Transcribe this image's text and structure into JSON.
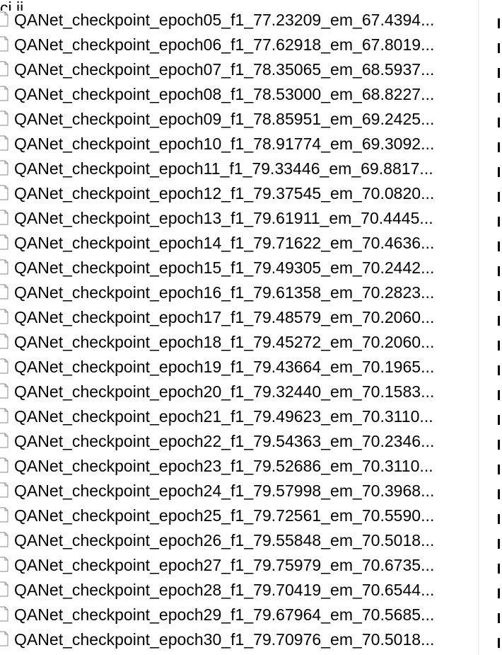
{
  "top_clipped_text": "ci ij",
  "files": [
    {
      "name": "QANet_checkpoint_epoch05_f1_77.23209_em_67.4394..."
    },
    {
      "name": "QANet_checkpoint_epoch06_f1_77.62918_em_67.8019..."
    },
    {
      "name": "QANet_checkpoint_epoch07_f1_78.35065_em_68.5937..."
    },
    {
      "name": "QANet_checkpoint_epoch08_f1_78.53000_em_68.8227..."
    },
    {
      "name": "QANet_checkpoint_epoch09_f1_78.85951_em_69.2425..."
    },
    {
      "name": "QANet_checkpoint_epoch10_f1_78.91774_em_69.3092..."
    },
    {
      "name": "QANet_checkpoint_epoch11_f1_79.33446_em_69.8817..."
    },
    {
      "name": "QANet_checkpoint_epoch12_f1_79.37545_em_70.0820..."
    },
    {
      "name": "QANet_checkpoint_epoch13_f1_79.61911_em_70.4445..."
    },
    {
      "name": "QANet_checkpoint_epoch14_f1_79.71622_em_70.4636..."
    },
    {
      "name": "QANet_checkpoint_epoch15_f1_79.49305_em_70.2442..."
    },
    {
      "name": "QANet_checkpoint_epoch16_f1_79.61358_em_70.2823..."
    },
    {
      "name": "QANet_checkpoint_epoch17_f1_79.48579_em_70.2060..."
    },
    {
      "name": "QANet_checkpoint_epoch18_f1_79.45272_em_70.2060..."
    },
    {
      "name": "QANet_checkpoint_epoch19_f1_79.43664_em_70.1965..."
    },
    {
      "name": "QANet_checkpoint_epoch20_f1_79.32440_em_70.1583..."
    },
    {
      "name": "QANet_checkpoint_epoch21_f1_79.49623_em_70.3110..."
    },
    {
      "name": "QANet_checkpoint_epoch22_f1_79.54363_em_70.2346..."
    },
    {
      "name": "QANet_checkpoint_epoch23_f1_79.52686_em_70.3110..."
    },
    {
      "name": "QANet_checkpoint_epoch24_f1_79.57998_em_70.3968..."
    },
    {
      "name": "QANet_checkpoint_epoch25_f1_79.72561_em_70.5590..."
    },
    {
      "name": "QANet_checkpoint_epoch26_f1_79.55848_em_70.5018..."
    },
    {
      "name": "QANet_checkpoint_epoch27_f1_79.75979_em_70.6735..."
    },
    {
      "name": "QANet_checkpoint_epoch28_f1_79.70419_em_70.6544..."
    },
    {
      "name": "QANet_checkpoint_epoch29_f1_79.67964_em_70.5685..."
    },
    {
      "name": "QANet_checkpoint_epoch30_f1_79.70976_em_70.5018..."
    }
  ],
  "icons": {
    "file": "file-icon"
  }
}
